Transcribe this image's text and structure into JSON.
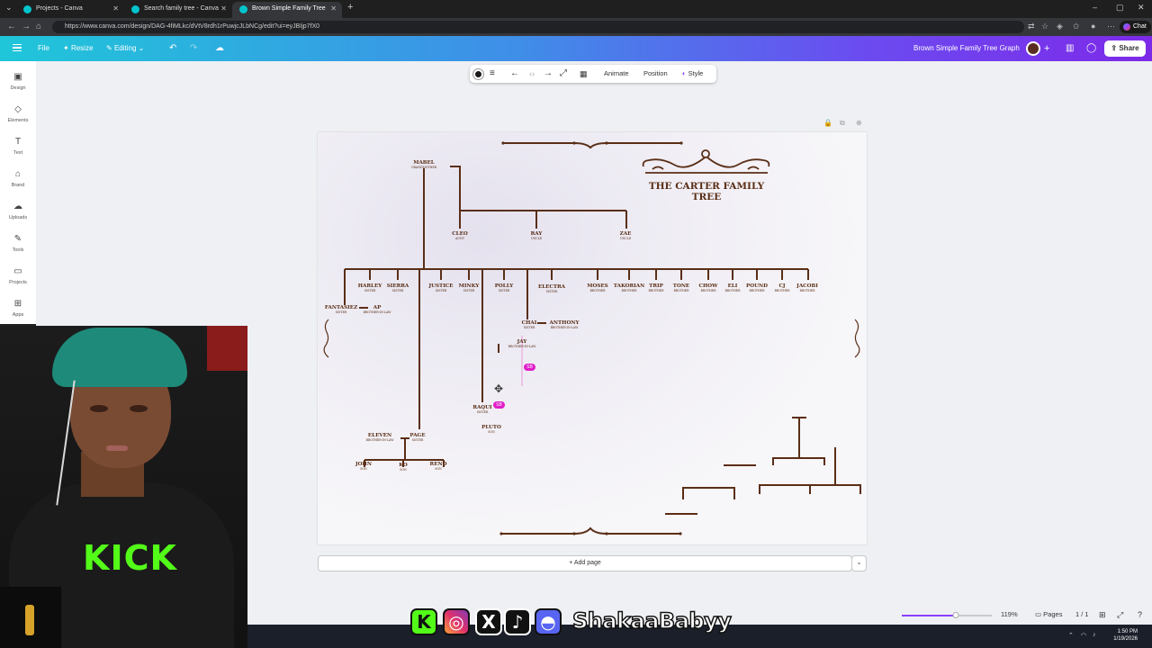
{
  "browser": {
    "tabs": [
      {
        "label": "Projects - Canva"
      },
      {
        "label": "Search family tree - Canva"
      },
      {
        "label": "Brown Simple Family Tree Graph"
      }
    ],
    "url": "https://www.canva.com/design/DAG-4fiMLkc/dVtV8rdh1rPuwjcJLbNCg/edit?ui=eyJBIjp7fX0",
    "chat_label": "Chat"
  },
  "header": {
    "file_label": "File",
    "resize_label": "Resize",
    "editing_label": "Editing",
    "doc_title": "Brown Simple Family Tree Graph",
    "share_label": "Share"
  },
  "sidebar": {
    "items": [
      {
        "label": "Design",
        "icon": "design-icon"
      },
      {
        "label": "Elements",
        "icon": "elements-icon"
      },
      {
        "label": "Text",
        "icon": "text-icon"
      },
      {
        "label": "Brand",
        "icon": "brand-icon"
      },
      {
        "label": "Uploads",
        "icon": "uploads-icon"
      },
      {
        "label": "Tools",
        "icon": "tools-icon"
      },
      {
        "label": "Projects",
        "icon": "projects-icon"
      },
      {
        "label": "Apps",
        "icon": "apps-icon"
      }
    ]
  },
  "toolbar": {
    "animate_label": "Animate",
    "position_label": "Position",
    "style_label": "Style"
  },
  "design": {
    "title_line1": "THE CARTER FAMILY",
    "title_line2": "TREE",
    "people": [
      {
        "name": "MABEL",
        "role": "GRANDMOTHER"
      },
      {
        "name": "CLEO",
        "role": "AUNT"
      },
      {
        "name": "RAY",
        "role": "UNCLE"
      },
      {
        "name": "ZAE",
        "role": "UNCLE"
      },
      {
        "name": "HARLEY",
        "role": "SISTER"
      },
      {
        "name": "SIERRA",
        "role": "SISTER"
      },
      {
        "name": "JUSTICE",
        "role": "SISTER"
      },
      {
        "name": "MINKY",
        "role": "SISTER"
      },
      {
        "name": "POLLY",
        "role": "SISTER"
      },
      {
        "name": "ELECTRA",
        "role": "SISTER"
      },
      {
        "name": "MOSES",
        "role": "BROTHER"
      },
      {
        "name": "TAKORIAN",
        "role": "BROTHER"
      },
      {
        "name": "TRIP",
        "role": "BROTHER"
      },
      {
        "name": "TONE",
        "role": "BROTHER"
      },
      {
        "name": "CHOW",
        "role": "BROTHER"
      },
      {
        "name": "ELI",
        "role": "BROTHER"
      },
      {
        "name": "POUND",
        "role": "BROTHER"
      },
      {
        "name": "CJ",
        "role": "BROTHER"
      },
      {
        "name": "JACOBI",
        "role": "BROTHER"
      },
      {
        "name": "FANTASIEZ",
        "role": "SISTER"
      },
      {
        "name": "AP",
        "role": "BROTHER-IN-LAW"
      },
      {
        "name": "CHAI",
        "role": "SISTER"
      },
      {
        "name": "ANTHONY",
        "role": "BROTHER-IN-LAW"
      },
      {
        "name": "JAY",
        "role": "BROTHER-IN-LAW"
      },
      {
        "name": "RAQUI",
        "role": "SISTER"
      },
      {
        "name": "PLUTO",
        "role": "SON"
      },
      {
        "name": "ELEVEN",
        "role": "BROTHER-IN-LAW"
      },
      {
        "name": "PAGE",
        "role": "SISTER"
      },
      {
        "name": "JOHN",
        "role": "SON"
      },
      {
        "name": "KO",
        "role": "SON"
      },
      {
        "name": "RENO",
        "role": "SON"
      }
    ],
    "badges": [
      "SB",
      "SB"
    ]
  },
  "add_page_label": "+ Add page",
  "footer": {
    "zoom": "119%",
    "zoom_fraction": 0.6,
    "pages_label": "Pages",
    "page_count": "1 / 1"
  },
  "webcam": {
    "shirt_text": "KICK"
  },
  "overlay": {
    "handle": "ShakaaBabyy"
  },
  "taskbar": {
    "time": "1:50 PM",
    "date": "1/19/2026"
  },
  "colors": {
    "accent": "#8b3dff",
    "tree_brown": "#5a2e16",
    "badge": "#e01ec9"
  }
}
